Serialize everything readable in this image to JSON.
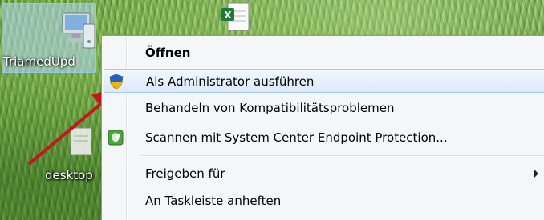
{
  "desktop": {
    "icons": [
      {
        "label": "TriamedUpd",
        "icon": "computer-update-icon",
        "selected": true
      },
      {
        "label": "desktop",
        "icon": "desktop-file-icon",
        "selected": false
      },
      {
        "label": "",
        "icon": "excel-file-icon",
        "selected": false
      }
    ]
  },
  "context_menu": {
    "items": [
      {
        "label": "Öffnen",
        "bold": true
      },
      {
        "label": "Als Administrator ausführen",
        "icon": "uac-shield-icon",
        "highlighted": true
      },
      {
        "label": "Behandeln von Kompatibilitätsproblemen"
      },
      {
        "label": "Scannen mit System Center Endpoint Protection...",
        "icon": "endpoint-protection-icon"
      },
      {
        "label": "Freigeben für",
        "submenu": true
      },
      {
        "label": "An Taskleiste anheften"
      }
    ]
  },
  "annotation": {
    "arrow_color": "#c8141e"
  }
}
